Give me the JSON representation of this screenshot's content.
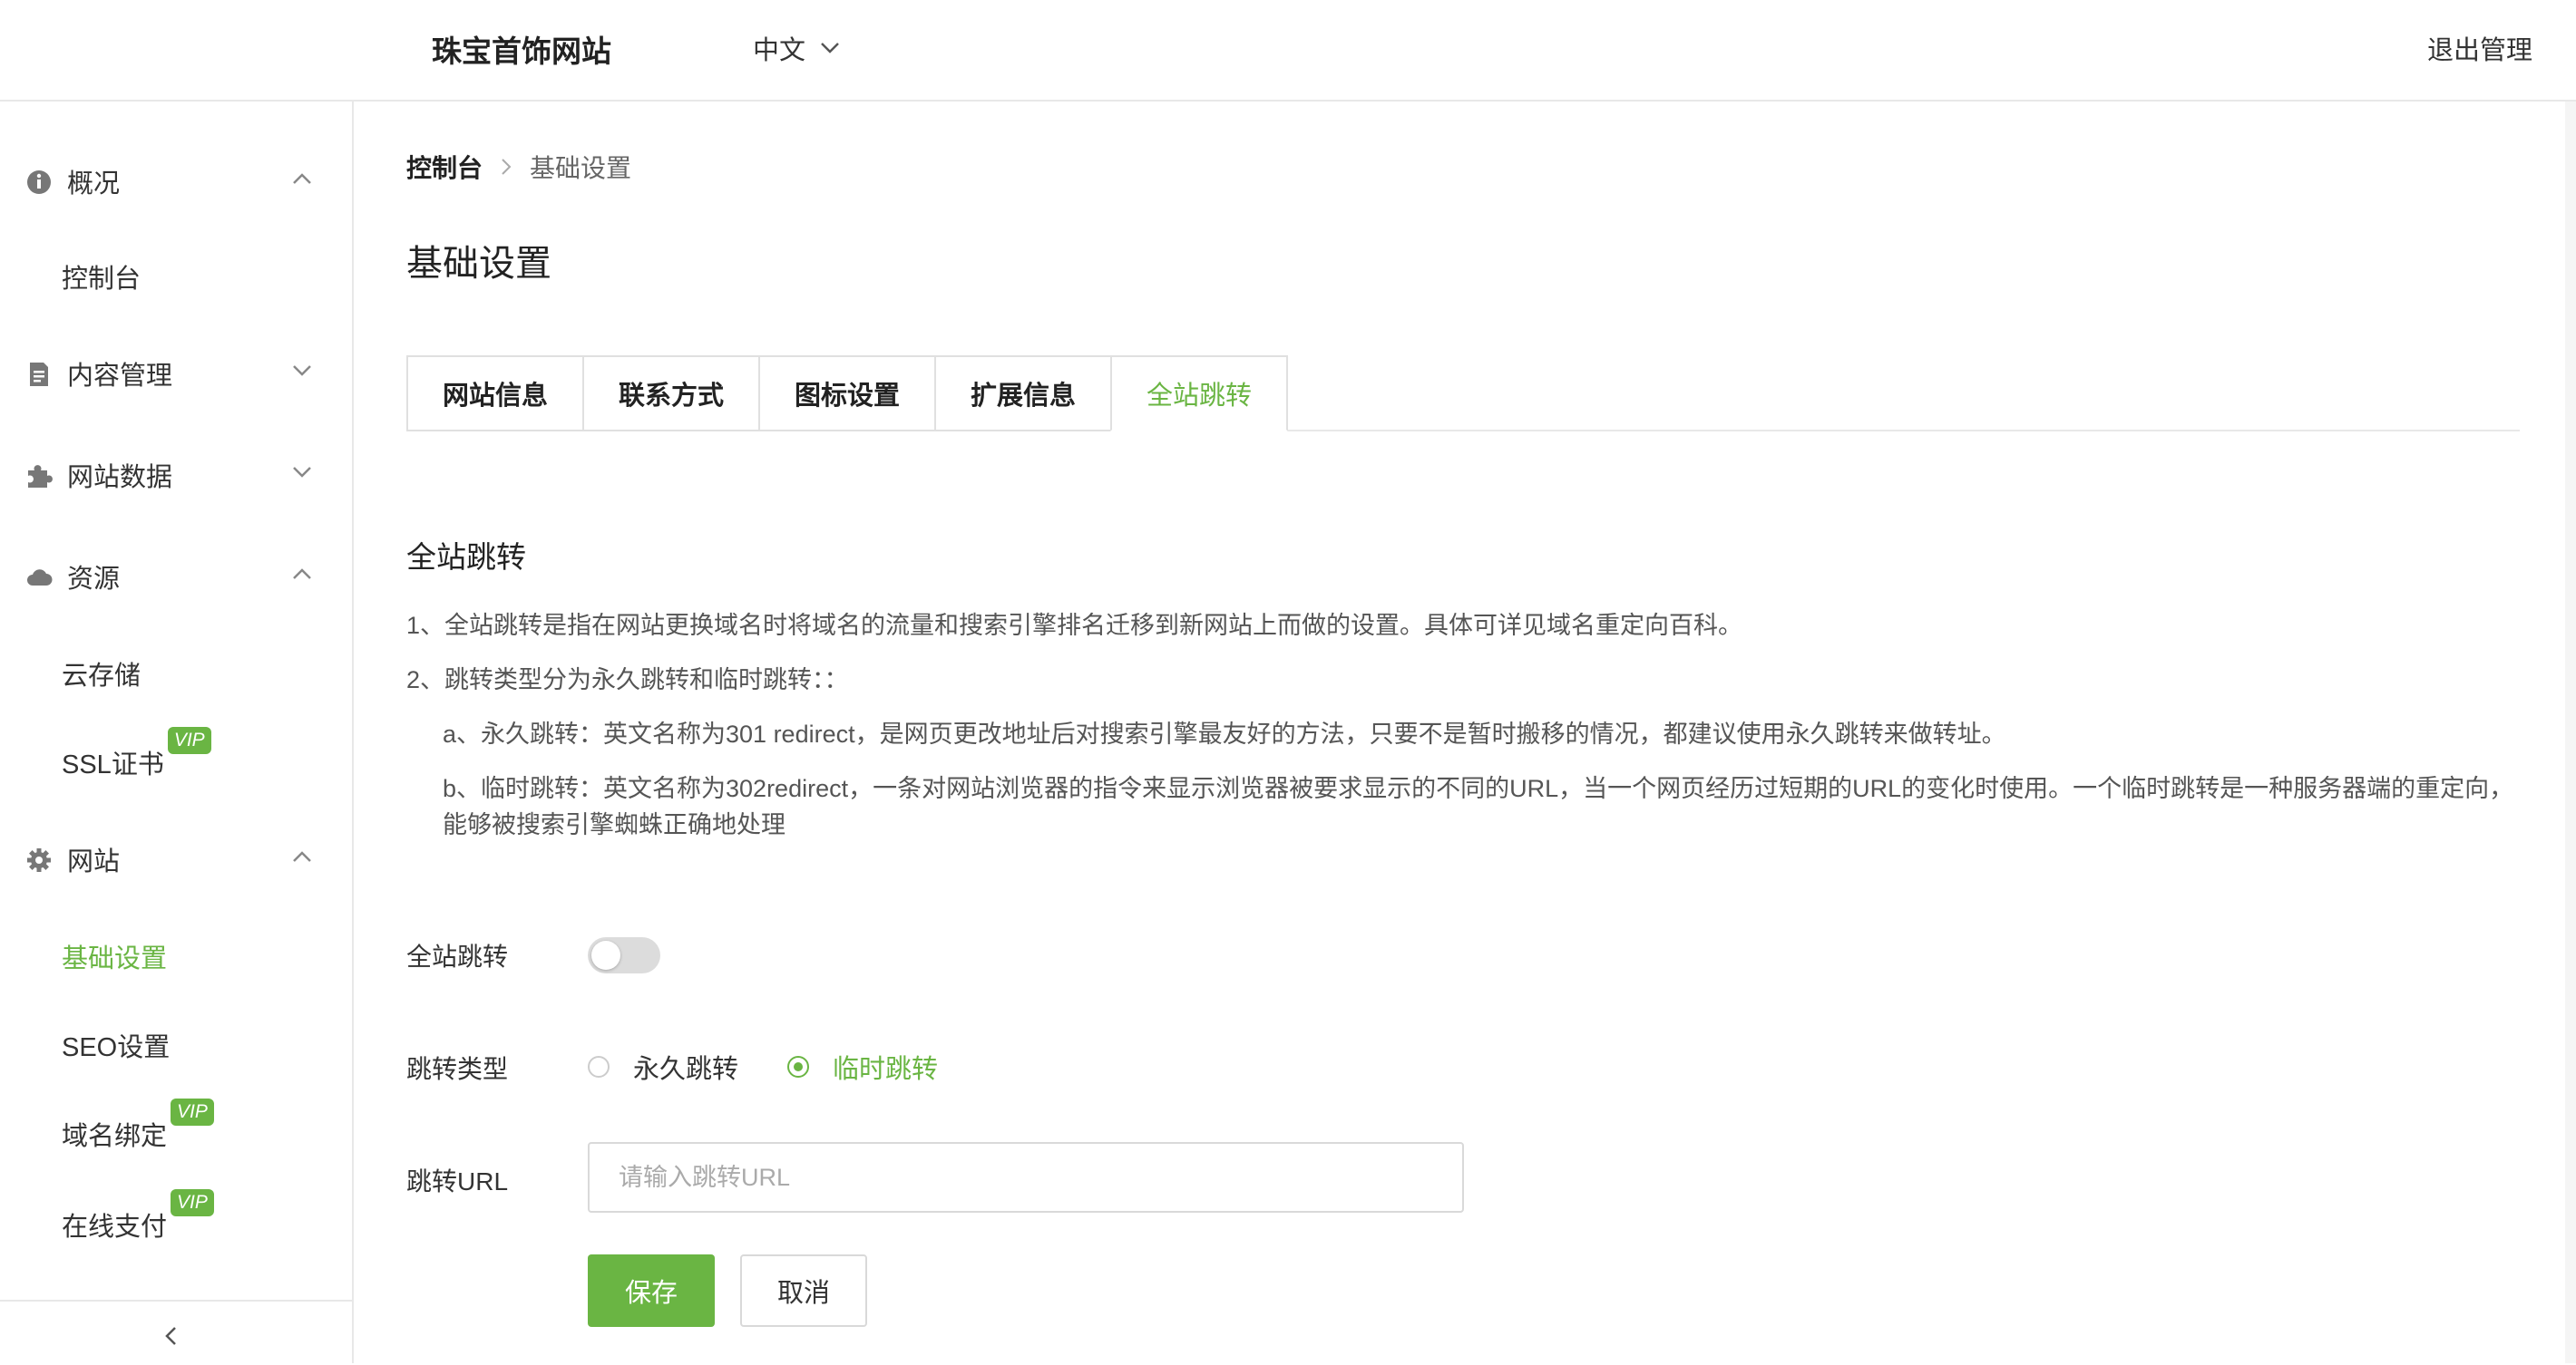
{
  "header": {
    "site_title": "珠宝首饰网站",
    "language": "中文",
    "logout": "退出管理"
  },
  "sidebar": {
    "groups": [
      {
        "label": "概况",
        "icon": "info-icon",
        "expanded": true
      },
      {
        "label": "内容管理",
        "icon": "document-icon",
        "expanded": false
      },
      {
        "label": "网站数据",
        "icon": "puzzle-icon",
        "expanded": false
      },
      {
        "label": "资源",
        "icon": "cloud-icon",
        "expanded": true
      },
      {
        "label": "网站",
        "icon": "gear-icon",
        "expanded": true
      }
    ],
    "items": {
      "console": "控制台",
      "cloud_storage": "云存储",
      "ssl": "SSL证书",
      "basic_settings": "基础设置",
      "seo": "SEO设置",
      "domain": "域名绑定",
      "payment": "在线支付"
    },
    "vip_badge": "VIP"
  },
  "breadcrumb": {
    "home": "控制台",
    "current": "基础设置"
  },
  "page_title": "基础设置",
  "tabs": [
    {
      "label": "网站信息",
      "active": false
    },
    {
      "label": "联系方式",
      "active": false
    },
    {
      "label": "图标设置",
      "active": false
    },
    {
      "label": "扩展信息",
      "active": false
    },
    {
      "label": "全站跳转",
      "active": true
    }
  ],
  "section": {
    "title": "全站跳转",
    "desc1": "1、全站跳转是指在网站更换域名时将域名的流量和搜索引擎排名迁移到新网站上而做的设置。具体可详见域名重定向百科。",
    "desc2": "2、跳转类型分为永久跳转和临时跳转：：",
    "desc3": "a、永久跳转：英文名称为301 redirect，是网页更改地址后对搜索引擎最友好的方法，只要不是暂时搬移的情况，都建议使用永久跳转来做转址。",
    "desc4": "b、临时跳转：英文名称为302redirect，一条对网站浏览器的指令来显示浏览器被要求显示的不同的URL，当一个网页经历过短期的URL的变化时使用。一个临时跳转是一种服务器端的重定向，能够被搜索引擎蜘蛛正确地处理"
  },
  "form": {
    "redirect_label": "全站跳转",
    "redirect_enabled": false,
    "type_label": "跳转类型",
    "type_options": [
      "永久跳转",
      "临时跳转"
    ],
    "type_selected": "临时跳转",
    "url_label": "跳转URL",
    "url_placeholder": "请输入跳转URL",
    "url_value": "",
    "save": "保存",
    "cancel": "取消"
  },
  "colors": {
    "accent": "#6ab543",
    "border": "#e8e8e8"
  }
}
